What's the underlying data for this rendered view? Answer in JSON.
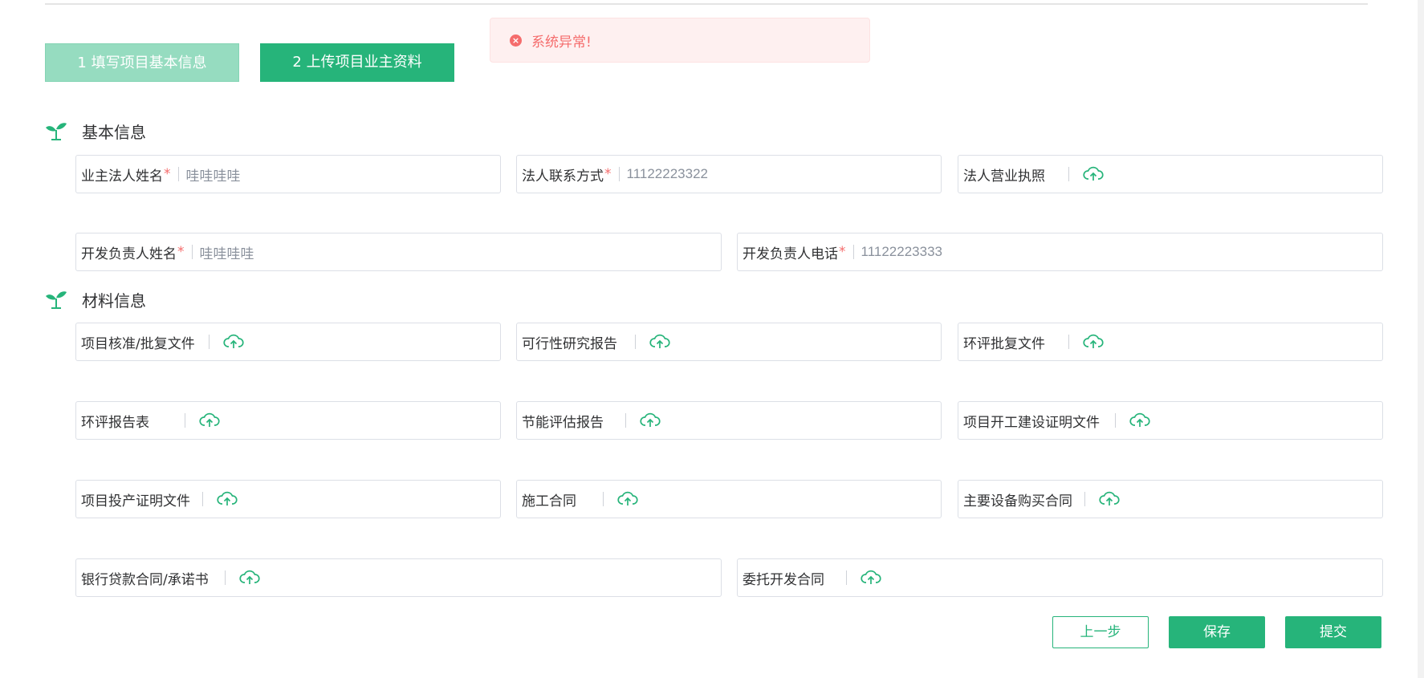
{
  "steps": [
    {
      "label": "1 填写项目基本信息",
      "state": "done"
    },
    {
      "label": "2 上传项目业主资料",
      "state": "active"
    }
  ],
  "toast": {
    "message": "系统异常!",
    "type": "error",
    "icon": "error-circle-icon"
  },
  "sections": {
    "basic": {
      "title": "基本信息",
      "icon": "sprout-icon"
    },
    "material": {
      "title": "材料信息",
      "icon": "sprout-icon"
    }
  },
  "basic_fields": {
    "owner_legal_name": {
      "label": "业主法人姓名",
      "required": "*",
      "value": "哇哇哇哇"
    },
    "legal_contact": {
      "label": "法人联系方式",
      "required": "*",
      "value": "11122223322"
    },
    "business_license": {
      "label": "法人营业执照",
      "upload_icon": "cloud-upload-icon"
    },
    "dev_lead_name": {
      "label": "开发负责人姓名",
      "required": "*",
      "value": "哇哇哇哇"
    },
    "dev_lead_phone": {
      "label": "开发负责人电话",
      "required": "*",
      "value": "11122223333"
    }
  },
  "material_fields": [
    {
      "label": "项目核准/批复文件"
    },
    {
      "label": "可行性研究报告"
    },
    {
      "label": "环评批复文件"
    },
    {
      "label": "环评报告表"
    },
    {
      "label": "节能评估报告"
    },
    {
      "label": "项目开工建设证明文件"
    },
    {
      "label": "项目投产证明文件"
    },
    {
      "label": "施工合同"
    },
    {
      "label": "主要设备购买合同"
    },
    {
      "label": "银行贷款合同/承诺书"
    },
    {
      "label": "委托开发合同"
    }
  ],
  "buttons": {
    "prev": "上一步",
    "save": "保存",
    "submit": "提交"
  },
  "colors": {
    "primary": "#26b47a",
    "step_done": "#96dcc0",
    "error": "#f56c6c",
    "error_bg": "#fef0f0"
  }
}
